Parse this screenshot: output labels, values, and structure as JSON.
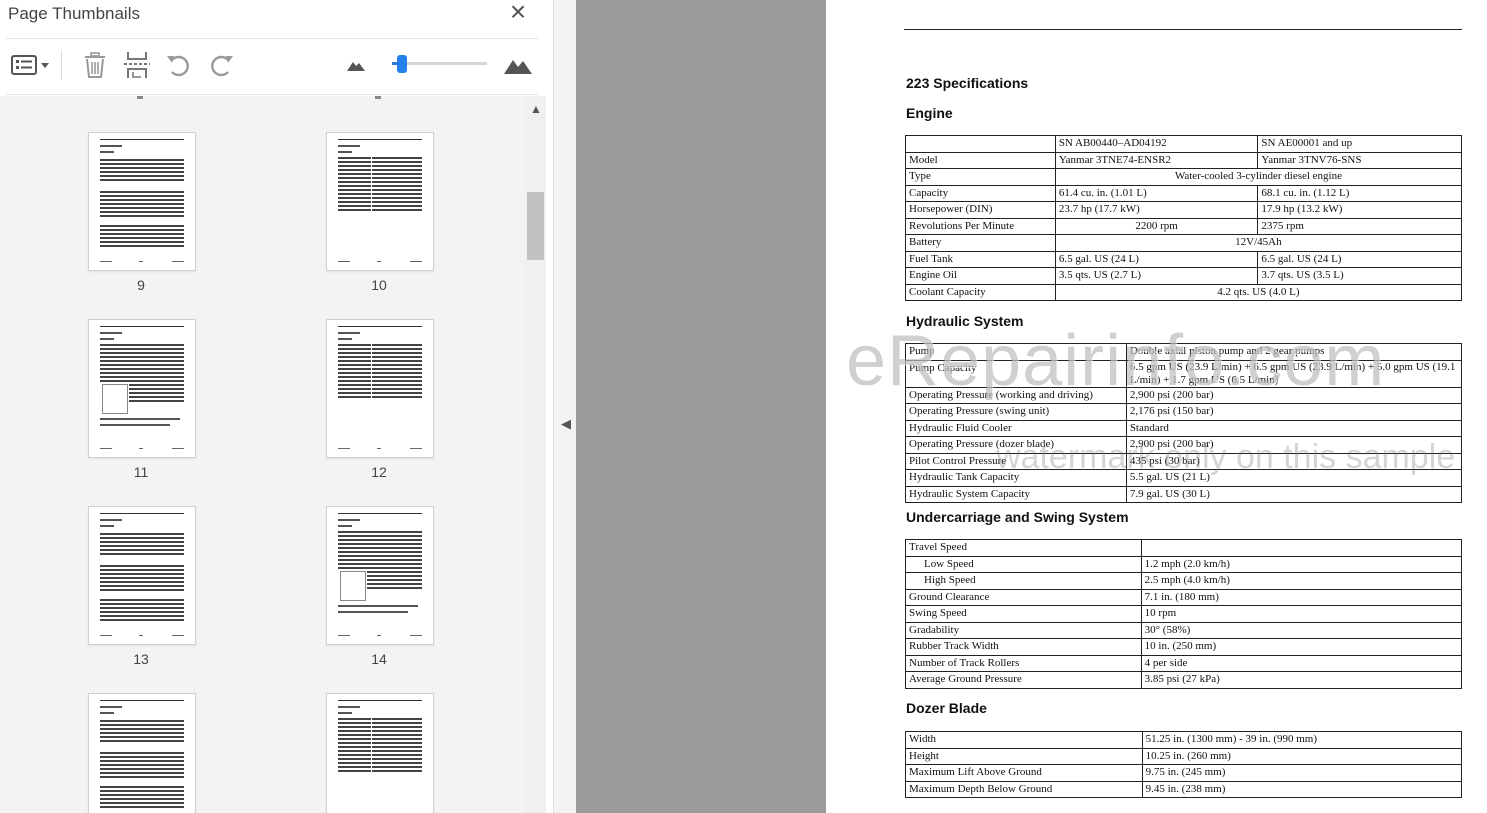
{
  "panel": {
    "title": "Page Thumbnails",
    "icons": {
      "close": "close-icon",
      "options": "list-options-icon",
      "delete": "trash-icon",
      "insert": "insert-page-icon",
      "undo": "rotate-counterclockwise-icon",
      "redo": "rotate-clockwise-icon",
      "zoom_out": "small-mountain-icon",
      "zoom_in": "large-mountain-icon"
    },
    "thumb_size_slider": 0.05,
    "thumbnails": [
      {
        "label": "9"
      },
      {
        "label": "10"
      },
      {
        "label": "11"
      },
      {
        "label": "12"
      },
      {
        "label": "13"
      },
      {
        "label": "14"
      },
      {
        "label": ""
      },
      {
        "label": ""
      }
    ]
  },
  "doc": {
    "section_title": "223 Specifications",
    "engine": {
      "heading": "Engine",
      "col1": "SN AB00440–AD04192",
      "col2": "SN AE00001 and up",
      "rows": [
        {
          "label": "Model",
          "a": "Yanmar 3TNE74-ENSR2",
          "b": "Yanmar 3TNV76-SNS"
        },
        {
          "label": "Type",
          "span": "Water-cooled 3-cylinder diesel engine"
        },
        {
          "label": "Capacity",
          "a": "61.4 cu. in. (1.01 L)",
          "b": "68.1 cu. in. (1.12 L)"
        },
        {
          "label": "Horsepower (DIN)",
          "a": "23.7 hp (17.7 kW)",
          "b": "17.9 hp (13.2 kW)"
        },
        {
          "label": "Revolutions Per Minute",
          "a": "2200 rpm",
          "b": "2375 rpm"
        },
        {
          "label": "Battery",
          "span": "12V/45Ah"
        },
        {
          "label": "Fuel Tank",
          "a": "6.5 gal. US (24 L)",
          "b": "6.5 gal. US (24 L)"
        },
        {
          "label": "Engine Oil",
          "a": "3.5 qts. US (2.7 L)",
          "b": "3.7 qts. US (3.5 L)"
        },
        {
          "label": "Coolant Capacity",
          "span": "4.2 qts. US (4.0 L)"
        }
      ]
    },
    "hydraulic": {
      "heading": "Hydraulic System",
      "rows": [
        {
          "label": "Pump",
          "value": "Double axial piston pump and 2 gear pumps"
        },
        {
          "label": "Pump Capacity",
          "value": "6.5 gpm US (23.9 L/min) + 6.5 gpm US (23.9 L/min) + 5.0 gpm US (19.1 L/min) + 1.7 gpm US (6.5 L/min)"
        },
        {
          "label": "Operating Pressure (working and driving)",
          "value": "2,900 psi (200 bar)"
        },
        {
          "label": "Operating Pressure (swing unit)",
          "value": "2,176 psi (150 bar)"
        },
        {
          "label": "Hydraulic Fluid Cooler",
          "value": "Standard"
        },
        {
          "label": "Operating Pressure (dozer blade)",
          "value": "2,900 psi (200 bar)"
        },
        {
          "label": "Pilot Control Pressure",
          "value": "435 psi (30 bar)"
        },
        {
          "label": "Hydraulic Tank Capacity",
          "value": "5.5 gal. US (21 L)"
        },
        {
          "label": "Hydraulic System Capacity",
          "value": "7.9 gal. US (30 L)"
        }
      ]
    },
    "undercarriage": {
      "heading": "Undercarriage and Swing System",
      "rows": [
        {
          "label": "Travel Speed",
          "value": ""
        },
        {
          "label": "Low Speed",
          "value": "1.2 mph (2.0 km/h)"
        },
        {
          "label": "High Speed",
          "value": "2.5 mph (4.0 km/h)"
        },
        {
          "label": "Ground Clearance",
          "value": "7.1 in. (180 mm)"
        },
        {
          "label": "Swing Speed",
          "value": "10 rpm"
        },
        {
          "label": "Gradability",
          "value": "30° (58%)"
        },
        {
          "label": "Rubber Track Width",
          "value": "10 in. (250 mm)"
        },
        {
          "label": "Number of Track Rollers",
          "value": "4 per side"
        },
        {
          "label": "Average Ground Pressure",
          "value": "3.85 psi (27 kPa)"
        }
      ]
    },
    "dozer": {
      "heading": "Dozer Blade",
      "rows": [
        {
          "label": "Width",
          "value": "51.25 in. (1300 mm) - 39 in. (990 mm)"
        },
        {
          "label": "Height",
          "value": "10.25 in. (260 mm)"
        },
        {
          "label": "Maximum Lift Above Ground",
          "value": "9.75 in. (245 mm)"
        },
        {
          "label": "Maximum Depth Below Ground",
          "value": "9.45 in. (238 mm)"
        }
      ]
    },
    "watermark": "eRepairinfo.com",
    "watermark_sub": "watermark only on this sample"
  }
}
